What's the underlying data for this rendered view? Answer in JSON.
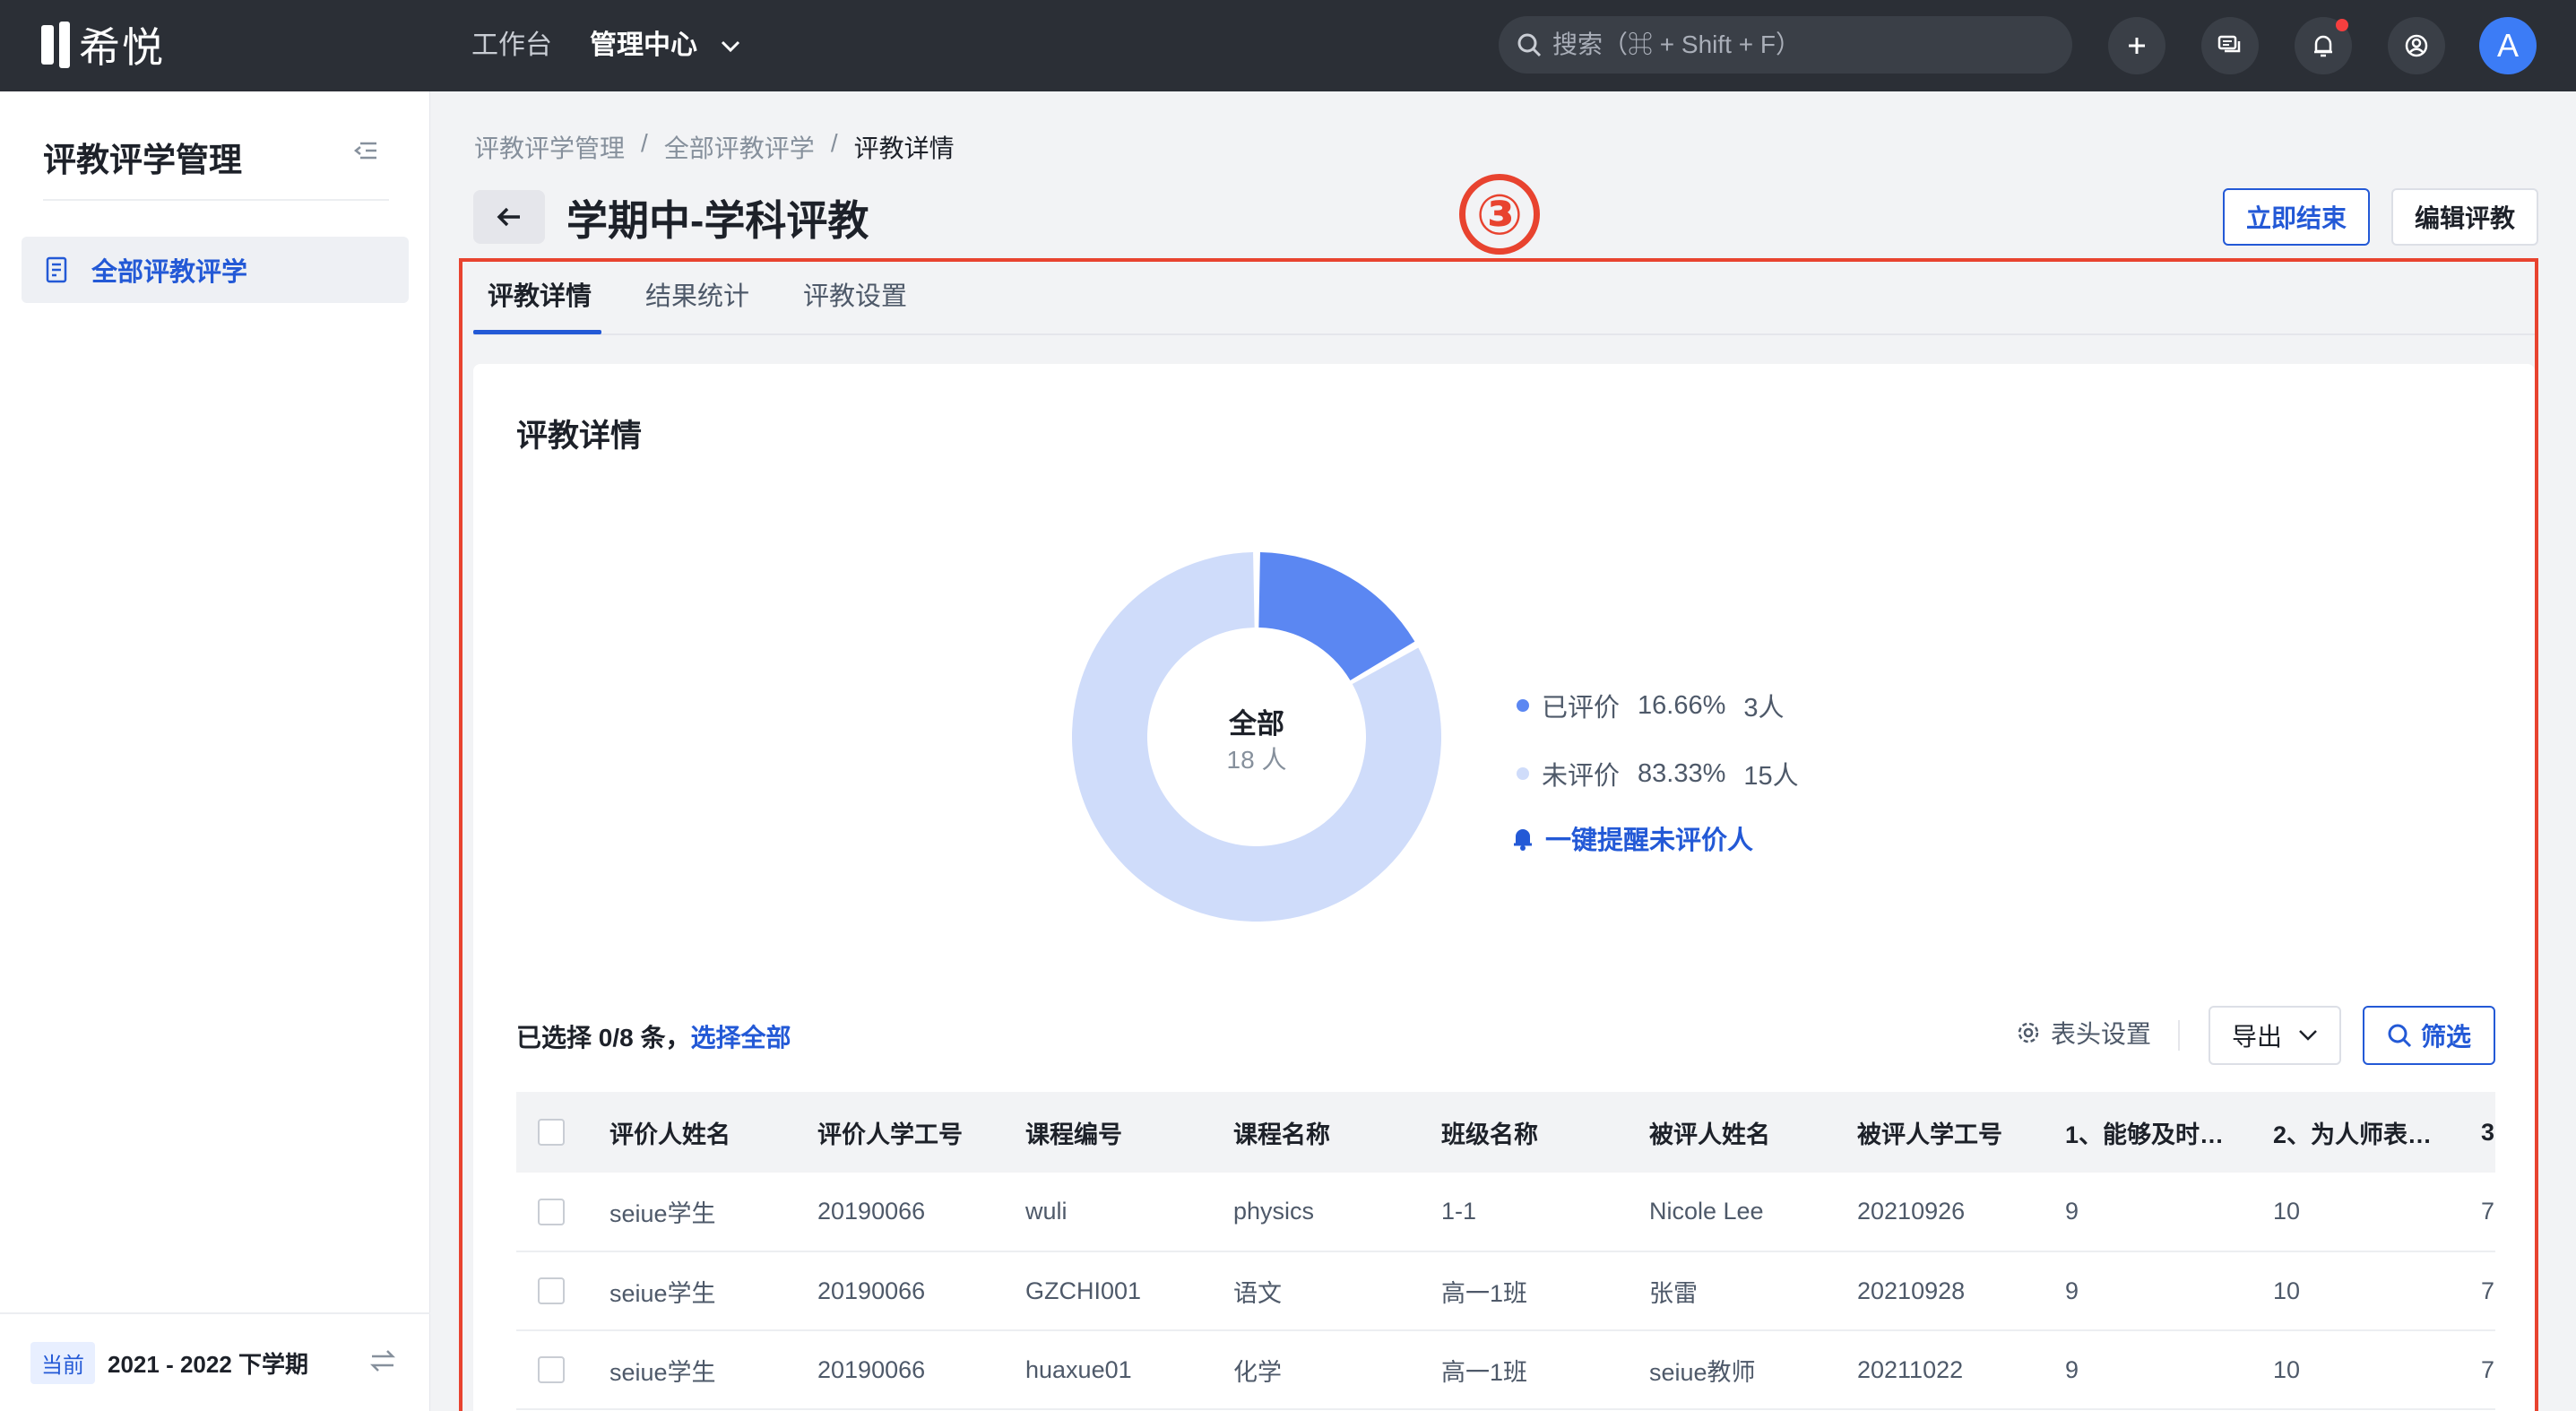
{
  "app": {
    "logo_text": "希悦"
  },
  "topnav": {
    "items": [
      "工作台",
      "管理中心"
    ],
    "search_placeholder": "搜索（⌘ + Shift + F）",
    "avatar_letter": "A"
  },
  "sidebar": {
    "title": "评教评学管理",
    "items": [
      {
        "label": "全部评教评学"
      }
    ],
    "term_tag": "当前",
    "term": "2021 - 2022 下学期"
  },
  "breadcrumb": [
    "评教评学管理",
    "/",
    "全部评教评学",
    "/",
    "评教详情"
  ],
  "page": {
    "title": "学期中-学科评教",
    "annotation": "③",
    "end_button": "立即结束",
    "edit_button": "编辑评教"
  },
  "tabs": [
    "评教详情",
    "结果统计",
    "评教设置"
  ],
  "card": {
    "title": "评教详情",
    "donut_title": "全部",
    "donut_sub": "18 人",
    "legend": [
      {
        "label": "已评价",
        "percent": "16.66%",
        "count": "3人",
        "color": "#5b87f2"
      },
      {
        "label": "未评价",
        "percent": "83.33%",
        "count": "15人",
        "color": "#cfdcfa"
      }
    ],
    "remind_label": "一键提醒未评价人"
  },
  "chart_data": {
    "type": "pie",
    "donut": true,
    "slices": [
      {
        "name": "已评价",
        "value": 3,
        "percent": 16.66
      },
      {
        "name": "未评价",
        "value": 15,
        "percent": 83.33
      }
    ]
  },
  "toolbar": {
    "selected": "已选择 0/8 条，",
    "select_all": "选择全部",
    "header_settings": "表头设置",
    "export": "导出",
    "filter": "筛选"
  },
  "table": {
    "columns": [
      "评价人姓名",
      "评价人学工号",
      "课程编号",
      "课程名称",
      "班级名称",
      "被评人姓名",
      "被评人学工号",
      "1、能够及时…",
      "2、为人师表…",
      "3"
    ],
    "rows": [
      [
        "seiue学生",
        "20190066",
        "wuli",
        "physics",
        "1-1",
        "Nicole Lee",
        "20210926",
        "9",
        "10",
        "7"
      ],
      [
        "seiue学生",
        "20190066",
        "GZCHI001",
        "语文",
        "高一1班",
        "张雷",
        "20210928",
        "9",
        "10",
        "7"
      ],
      [
        "seiue学生",
        "20190066",
        "huaxue01",
        "化学",
        "高一1班",
        "seiue教师",
        "20211022",
        "9",
        "10",
        "7"
      ]
    ]
  },
  "colors": {
    "accent": "#2359d6",
    "annotation": "#e8432f",
    "topbar": "#2b2f36"
  }
}
